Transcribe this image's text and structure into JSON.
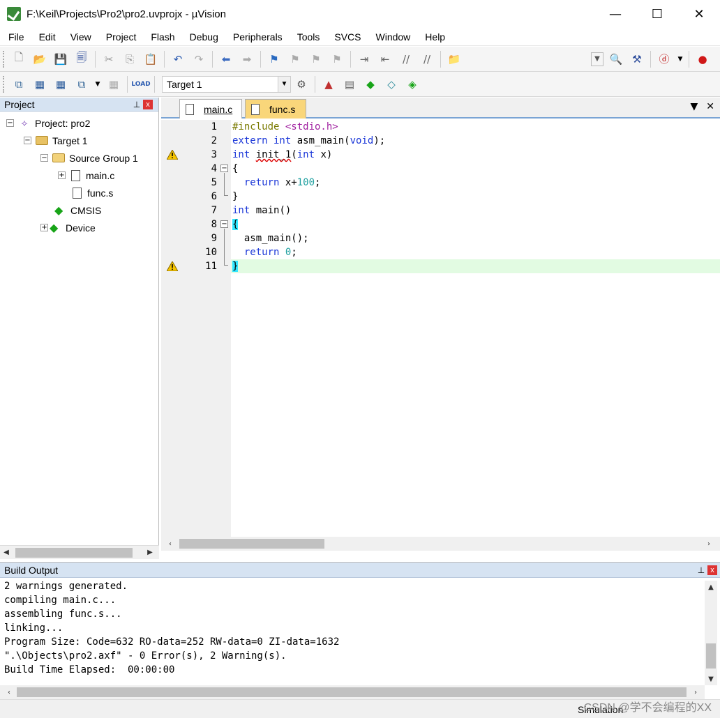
{
  "window": {
    "title": "F:\\Keil\\Projects\\Pro2\\pro2.uvprojx - µVision",
    "minimize": "—",
    "maximize": "☐",
    "close": "✕"
  },
  "menu": [
    "File",
    "Edit",
    "View",
    "Project",
    "Flash",
    "Debug",
    "Peripherals",
    "Tools",
    "SVCS",
    "Window",
    "Help"
  ],
  "toolbar2": {
    "target_select": "Target 1"
  },
  "project_panel": {
    "title": "Project",
    "pin": "📌",
    "close": "x",
    "tree": {
      "project": "Project: pro2",
      "target": "Target 1",
      "group": "Source Group 1",
      "file1": "main.c",
      "file2": "func.s",
      "cmsis": "CMSIS",
      "device": "Device"
    }
  },
  "editor": {
    "tabs": [
      {
        "label": "main.c",
        "active": true
      },
      {
        "label": "func.s",
        "active": false
      }
    ],
    "line_numbers": [
      "1",
      "2",
      "3",
      "4",
      "5",
      "6",
      "7",
      "8",
      "9",
      "10",
      "11"
    ],
    "code": {
      "l1_pp": "#include ",
      "l1_str": "<stdio.h>",
      "l2_kw1": "extern int",
      "l2_mid": " asm_main(",
      "l2_kw2": "void",
      "l2_end": ");",
      "l3_kw1": "int",
      "l3_sp": " ",
      "l3_fn": "init_1",
      "l3_p": "(",
      "l3_kw2": "int",
      "l3_end": " x)",
      "l4": "{",
      "l5_indent": "  ",
      "l5_kw": "return",
      "l5_mid": " x+",
      "l5_num": "100",
      "l5_end": ";",
      "l6": "}",
      "l7_kw": "int",
      "l7_end": " main()",
      "l8": "{",
      "l9": "  asm_main();",
      "l10_indent": "  ",
      "l10_kw": "return",
      "l10_sp": " ",
      "l10_num": "0",
      "l10_end": ";",
      "l11": "}"
    },
    "warning_lines": [
      3,
      11
    ],
    "highlight_line": 11
  },
  "build_output": {
    "title": "Build Output",
    "lines": [
      "2 warnings generated.",
      "compiling main.c...",
      "assembling func.s...",
      "linking...",
      "Program Size: Code=632 RO-data=252 RW-data=0 ZI-data=1632",
      "\".\\Objects\\pro2.axf\" - 0 Error(s), 2 Warning(s).",
      "Build Time Elapsed:  00:00:00"
    ]
  },
  "status": {
    "mode": "Simulation",
    "watermark": "CSDN @学不会编程的XX"
  },
  "colors": {
    "keyword": "#1a36d8",
    "preprocessor": "#7a7a00",
    "string": "#a020a0",
    "number": "#20a0a0",
    "panel_header": "#d6e3f2",
    "active_line": "#e2fbe2",
    "brace_match": "#33e6ff"
  }
}
